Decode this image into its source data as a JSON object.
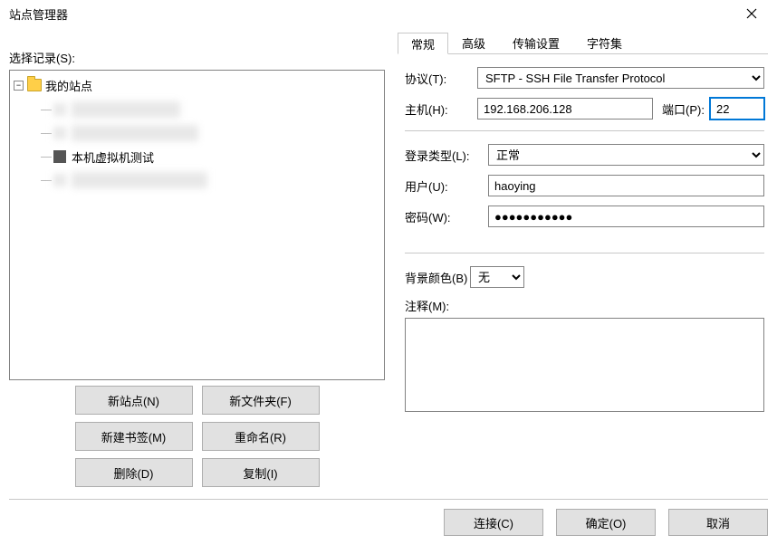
{
  "window": {
    "title": "站点管理器"
  },
  "tree": {
    "label": "选择记录(S):",
    "root": "我的站点",
    "visible_item": "本机虚拟机测试"
  },
  "buttons": {
    "new_site": "新站点(N)",
    "new_folder": "新文件夹(F)",
    "new_bookmark": "新建书签(M)",
    "rename": "重命名(R)",
    "delete": "删除(D)",
    "copy": "复制(I)"
  },
  "tabs": {
    "general": "常规",
    "advanced": "高级",
    "transfer": "传输设置",
    "charset": "字符集"
  },
  "form": {
    "protocol_label": "协议(T):",
    "protocol_value": "SFTP - SSH File Transfer Protocol",
    "host_label": "主机(H):",
    "host_value": "192.168.206.128",
    "port_label": "端口(P):",
    "port_value": "22",
    "logon_type_label": "登录类型(L):",
    "logon_type_value": "正常",
    "user_label": "用户(U):",
    "user_value": "haoying",
    "password_label": "密码(W):",
    "password_value": "●●●●●●●●●●●",
    "bg_color_label": "背景颜色(B)",
    "bg_color_value": "无",
    "comment_label": "注释(M):",
    "comment_value": ""
  },
  "footer": {
    "connect": "连接(C)",
    "ok": "确定(O)",
    "cancel": "取消"
  }
}
